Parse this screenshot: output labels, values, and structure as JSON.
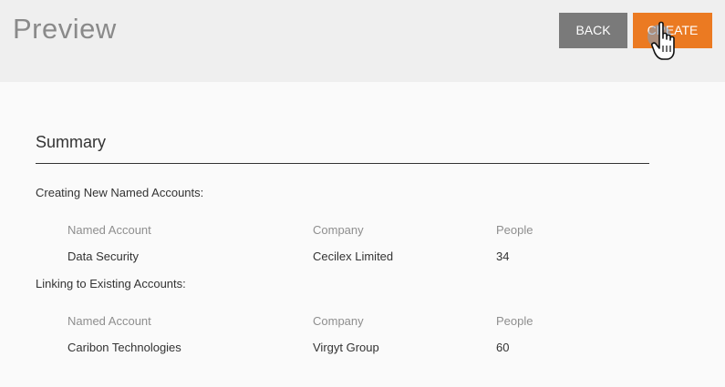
{
  "header": {
    "title": "Preview",
    "back_label": "BACK",
    "create_label": "CREATE"
  },
  "summary": {
    "title": "Summary",
    "sections": [
      {
        "label": "Creating New Named Accounts:",
        "columns": [
          "Named Account",
          "Company",
          "People"
        ],
        "rows": [
          {
            "named_account": "Data Security",
            "company": "Cecilex Limited",
            "people": "34"
          }
        ]
      },
      {
        "label": "Linking to Existing Accounts:",
        "columns": [
          "Named Account",
          "Company",
          "People"
        ],
        "rows": [
          {
            "named_account": "Caribon Technologies",
            "company": "Virgyt Group",
            "people": "60"
          }
        ]
      }
    ]
  },
  "colors": {
    "accent": "#eb7a22",
    "back_button": "#7a7a7a",
    "header_bg": "#efefef",
    "page_bg": "#fafafa"
  },
  "icons": {
    "cursor": "hand-pointer-icon"
  }
}
